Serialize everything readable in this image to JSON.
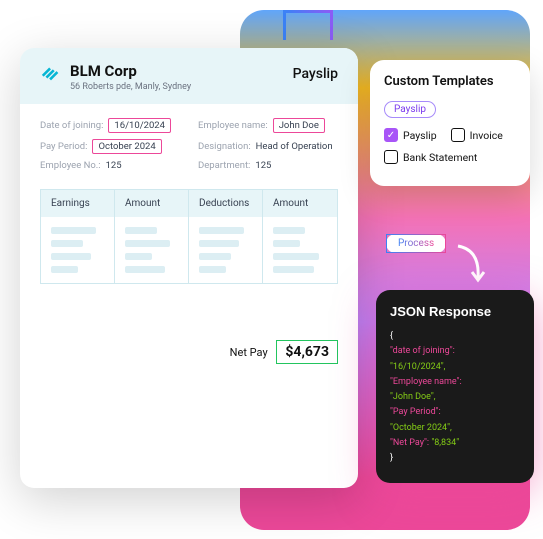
{
  "company": {
    "name": "BLM Corp",
    "address": "56 Roberts pde, Manly, Sydney"
  },
  "doc_type": "Payslip",
  "fields": {
    "date_joining_lbl": "Date of joining:",
    "date_joining_val": "16/10/2024",
    "emp_name_lbl": "Employee name:",
    "emp_name_val": "John Doe",
    "pay_period_lbl": "Pay Period:",
    "pay_period_val": "October 2024",
    "designation_lbl": "Designation:",
    "designation_val": "Head of Operation",
    "emp_no_lbl": "Employee No.:",
    "emp_no_val": "125",
    "department_lbl": "Department:",
    "department_val": "125"
  },
  "table_headers": {
    "c1": "Earnings",
    "c2": "Amount",
    "c3": "Deductions",
    "c4": "Amount"
  },
  "net_pay": {
    "label": "Net Pay",
    "value": "$4,673"
  },
  "templates": {
    "title": "Custom Templates",
    "selected_pill": "Payslip",
    "opt_payslip": "Payslip",
    "opt_invoice": "Invoice",
    "opt_bank": "Bank Statement"
  },
  "process_label": "Process",
  "json_response": {
    "title": "JSON Response",
    "k1": "\"date of joining\":",
    "v1": "\"16/10/2024\",",
    "k2": "\"Employee name\":",
    "v2": "\"John Doe\",",
    "k3": "\"Pay Period\":",
    "v3": "\"October 2024\",",
    "k4": "\"Net Pay\": ",
    "v4": "\"8,834\""
  }
}
